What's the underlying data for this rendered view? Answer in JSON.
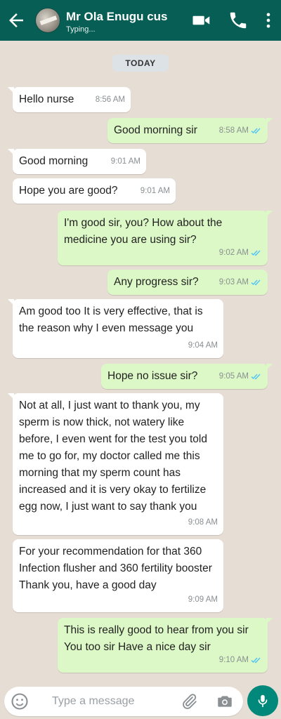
{
  "header": {
    "name": "Mr Ola Enugu cus",
    "status": "Typing..."
  },
  "day_label": "TODAY",
  "messages": [
    {
      "dir": "in",
      "text": "Hello nurse",
      "time": "8:56 AM"
    },
    {
      "dir": "out",
      "text": "Good morning sir",
      "time": "8:58 AM",
      "ticks": "read"
    },
    {
      "dir": "in",
      "text": "Good morning",
      "time": "9:01 AM"
    },
    {
      "dir": "in",
      "text": "Hope you are good?",
      "time": "9:01 AM"
    },
    {
      "dir": "out",
      "text": "I'm good sir, you? How about the medicine you are using sir?",
      "time": "9:02 AM",
      "ticks": "read"
    },
    {
      "dir": "out",
      "text": "Any progress sir?",
      "time": "9:03 AM",
      "ticks": "read"
    },
    {
      "dir": "in",
      "text": "Am good too It is very effective, that is the reason why I even message you",
      "time": "9:04 AM"
    },
    {
      "dir": "out",
      "text": "Hope no issue sir?",
      "time": "9:05 AM",
      "ticks": "read"
    },
    {
      "dir": "in",
      "text": "Not at all, I just want to thank you, my sperm is now thick, not watery like before, I even went for the test you told me to go for, my doctor called me this morning that my sperm count has increased and it is very okay to fertilize egg now, I just want to say thank you",
      "time": "9:08 AM"
    },
    {
      "dir": "in",
      "text": "For your recommendation for that 360 Infection flusher and 360 fertility booster Thank you, have a good day",
      "time": "9:09 AM"
    },
    {
      "dir": "out",
      "text": "This is really good to hear from you sir You too sir Have a nice day sir",
      "time": "9:10 AM",
      "ticks": "read"
    }
  ],
  "composer": {
    "placeholder": "Type a message"
  },
  "icons": {
    "back": "arrow-left-icon",
    "video": "video-call-icon",
    "phone": "phone-icon",
    "menu": "more-vert-icon",
    "emoji": "emoji-icon",
    "attach": "paperclip-icon",
    "camera": "camera-icon",
    "mic": "mic-icon",
    "read_ticks": "double-check-icon"
  },
  "colors": {
    "header": "#075e54",
    "outgoing": "#dcf8c6",
    "incoming": "#ffffff",
    "read_tick": "#4fc3f7",
    "mic_button": "#00897b"
  }
}
